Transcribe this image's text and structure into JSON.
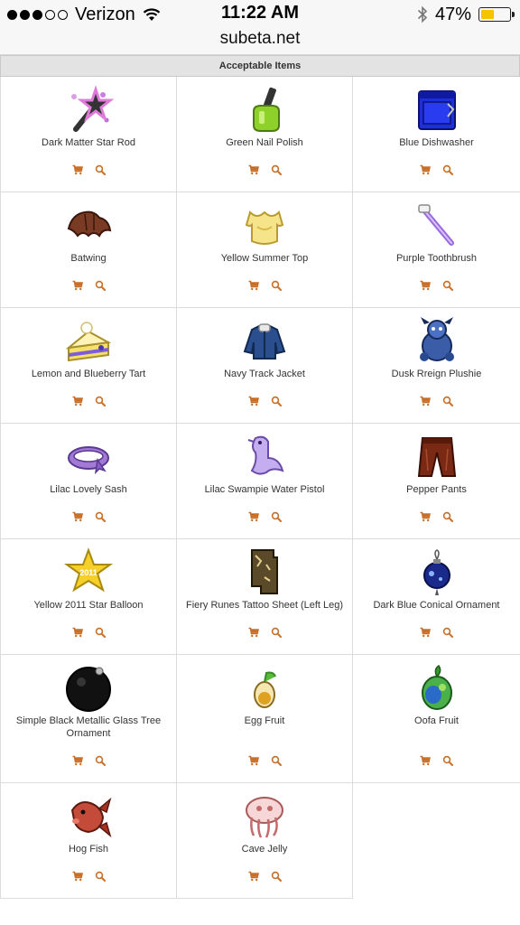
{
  "status_bar": {
    "carrier": "Verizon",
    "time": "11:22 AM",
    "battery_percent": "47%",
    "battery_level": 0.47,
    "signal_dots_filled": 3,
    "signal_dots_total": 5
  },
  "url_bar": {
    "url": "subeta.net"
  },
  "section": {
    "title": "Acceptable Items"
  },
  "colors": {
    "action_icon": "#c8702a",
    "border": "#dcdcdc",
    "header_bg": "#e3e3e3"
  },
  "items": [
    {
      "name": "Dark Matter Star Rod",
      "icon": "star-rod-icon"
    },
    {
      "name": "Green Nail Polish",
      "icon": "nail-polish-icon"
    },
    {
      "name": "Blue Dishwasher",
      "icon": "dishwasher-icon"
    },
    {
      "name": "Batwing",
      "icon": "batwing-icon"
    },
    {
      "name": "Yellow Summer Top",
      "icon": "summer-top-icon"
    },
    {
      "name": "Purple Toothbrush",
      "icon": "toothbrush-icon"
    },
    {
      "name": "Lemon and Blueberry Tart",
      "icon": "tart-icon"
    },
    {
      "name": "Navy Track Jacket",
      "icon": "jacket-icon"
    },
    {
      "name": "Dusk Rreign Plushie",
      "icon": "plushie-icon"
    },
    {
      "name": "Lilac Lovely Sash",
      "icon": "sash-icon"
    },
    {
      "name": "Lilac Swampie Water Pistol",
      "icon": "water-pistol-icon"
    },
    {
      "name": "Pepper Pants",
      "icon": "pants-icon"
    },
    {
      "name": "Yellow 2011 Star Balloon",
      "icon": "star-balloon-icon"
    },
    {
      "name": "Fiery Runes Tattoo Sheet (Left Leg)",
      "icon": "tattoo-sheet-icon"
    },
    {
      "name": "Dark Blue Conical Ornament",
      "icon": "conical-ornament-icon"
    },
    {
      "name": "Simple Black Metallic Glass Tree Ornament",
      "icon": "black-ornament-icon"
    },
    {
      "name": "Egg Fruit",
      "icon": "egg-fruit-icon"
    },
    {
      "name": "Oofa Fruit",
      "icon": "oofa-fruit-icon"
    },
    {
      "name": "Hog Fish",
      "icon": "hog-fish-icon"
    },
    {
      "name": "Cave Jelly",
      "icon": "cave-jelly-icon"
    }
  ]
}
